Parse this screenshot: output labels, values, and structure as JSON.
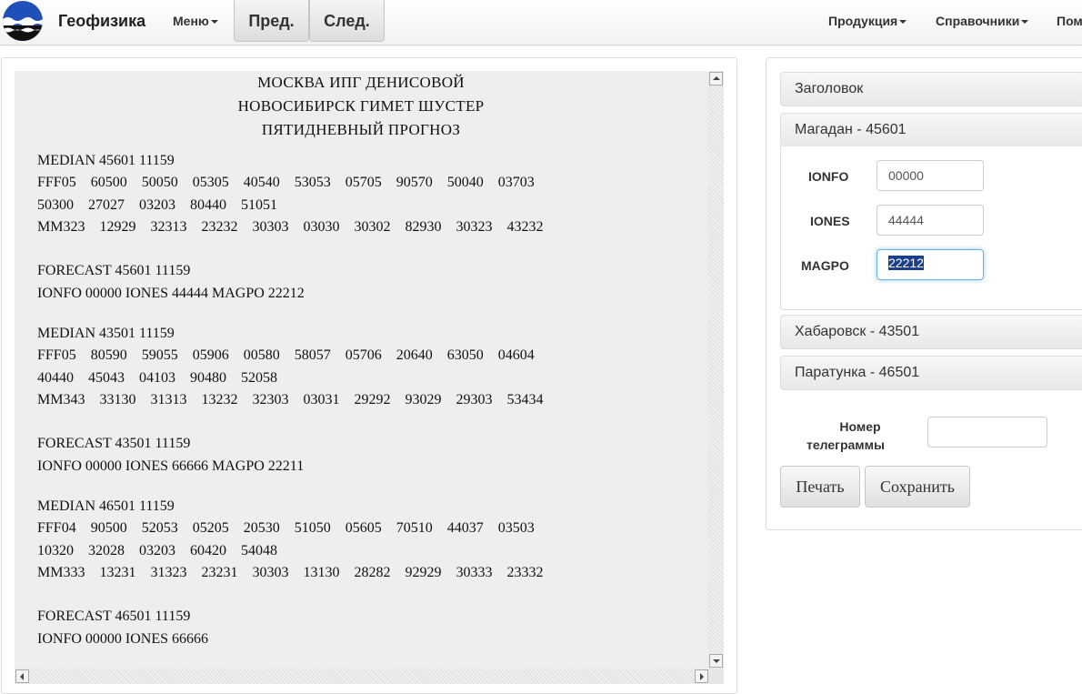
{
  "navbar": {
    "brand": "Геофизика",
    "menu": "Меню",
    "prev": "Пред.",
    "next": "След.",
    "products": "Продукция",
    "references": "Справочники",
    "help_partial": "Пом"
  },
  "telegram": {
    "header_lines": [
      "МОСКВА ИПГ ДЕНИСОВОЙ",
      "НОВОСИБИРСК ГИМЕТ ШУСТЕР",
      "ПЯТИДНЕВНЫЙ ПРОГНОЗ"
    ],
    "body_lines": [
      "MEDIAN 45601 11159",
      "FFF05    60500    50050    05305    40540    53053    05705    90570    50040    03703",
      "50300    27027    03203    80440    51051",
      "MM323    12929    32313    23232    30303    03030    30302    82930    30323    43232",
      "FORECAST 45601 11159",
      "IONFO 00000 IONES 44444 MAGPO 22212",
      "MEDIAN 43501 11159",
      "FFF05    80590    59055    05906    00580    58057    05706    20640    63050    04604",
      "40440    45043    04103    90480    52058",
      "MM343    33130    31313    13232    32303    03031    29292    93029    29303    53434",
      "FORECAST 43501 11159",
      "IONFO 00000 IONES 66666 MAGPO 22211",
      "MEDIAN 46501 11159",
      "FFF04    90500    52053    05205    20530    51050    05605    70510    44037    03503",
      "10320    32028    03203    60420    54048",
      "MM333    13231    31323    23231    30303    13130    28282    92929    30333    23332",
      "FORECAST 46501 11159",
      "IONFO 00000 IONES 66666"
    ]
  },
  "accordion": {
    "header": "Заголовок",
    "magadan": "Магадан - 45601",
    "khabarovsk": "Хабаровск - 43501",
    "paratunka": "Паратунка - 46501"
  },
  "form": {
    "ionfo_label": "IONFO",
    "ionfo_value": "00000",
    "iones_label": "IONES",
    "iones_value": "44444",
    "magpo_label": "MAGPO",
    "magpo_value": "22212",
    "telegram_number_label_1": "Номер",
    "telegram_number_label_2": "телеграммы",
    "telegram_number_value": ""
  },
  "buttons": {
    "print": "Печать",
    "save": "Сохранить"
  },
  "colors": {
    "selection": "#1b3f8b",
    "focus_border": "#66afe9",
    "textarea_bg": "#eeeeee"
  }
}
